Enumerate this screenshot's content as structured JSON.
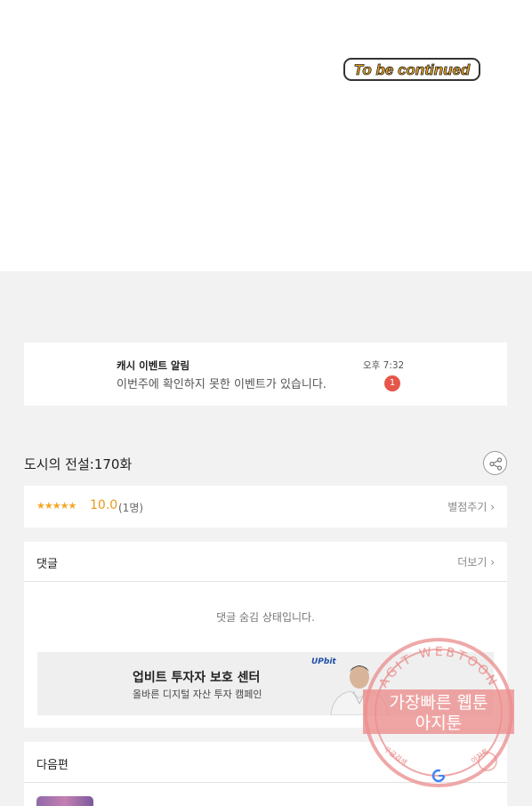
{
  "comic": {
    "end_banner": "To be continued"
  },
  "notice": {
    "title": "캐시 이벤트 알림",
    "body": "이번주에 확인하지 못한 이벤트가 있습니다.",
    "time": "오후 7:32",
    "badge_count": "1"
  },
  "series": {
    "title": "도시의 전설:170화"
  },
  "rating": {
    "stars": "★★★★★",
    "score": "10.0",
    "voters": "(1명)",
    "rate_button": "별점주기 ›"
  },
  "comments": {
    "heading": "댓글",
    "more_button": "더보기 ›",
    "hidden_message": "댓글 숨김 상태입니다."
  },
  "ad": {
    "title": "업비트 투자자 보호 센터",
    "subtitle": "올바른 디지털 자산 투자 캠페인",
    "brand": "UPbit"
  },
  "watermark": {
    "arc_text": "AGIT WEBTOON",
    "line1": "가장빠른 웹툰",
    "line2": "아지툰",
    "left_small": "구글검색",
    "right_small": "아지툰"
  },
  "next": {
    "heading": "다음편"
  },
  "colors": {
    "accent_star": "#f5a623",
    "badge": "#e4574a",
    "watermark": "#e98b8b"
  }
}
